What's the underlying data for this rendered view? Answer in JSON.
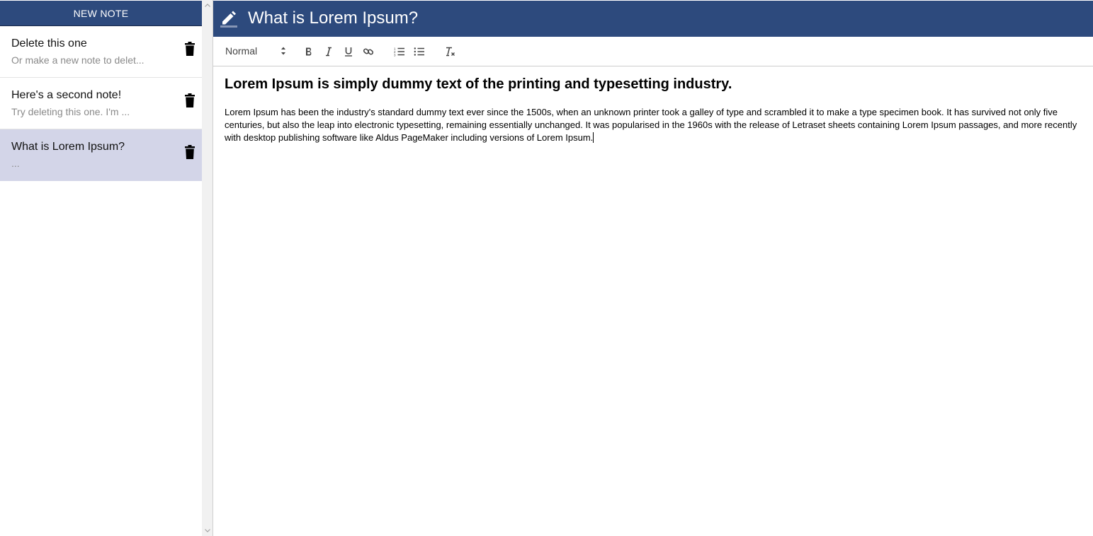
{
  "sidebar": {
    "new_note_label": "NEW NOTE",
    "notes": [
      {
        "title": "Delete this one",
        "preview": "Or make a new note to delet..."
      },
      {
        "title": "Here's a second note!",
        "preview": "Try deleting this one. I'm ..."
      },
      {
        "title": "What is Lorem Ipsum?",
        "preview": "..."
      }
    ],
    "selected_index": 2
  },
  "editor": {
    "title": "What is Lorem Ipsum?",
    "toolbar": {
      "format_value": "Normal",
      "buttons": [
        "bold-icon",
        "italic-icon",
        "underline-icon",
        "link-icon",
        "ordered-list-icon",
        "bullet-list-icon",
        "clear-format-icon"
      ]
    },
    "heading": "Lorem Ipsum is simply dummy text of the printing and typesetting industry.",
    "body": "Lorem Ipsum has been the industry's standard dummy text ever since the 1500s, when an unknown printer took a galley of type and scrambled it to make a type specimen book. It has survived not only five centuries, but also the leap into electronic typesetting, remaining essentially unchanged. It was popularised in the 1960s with the release of Letraset sheets containing Lorem Ipsum passages, and more recently with desktop publishing software like Aldus PageMaker including versions of Lorem Ipsum."
  },
  "colors": {
    "accent": "#2d4a7d",
    "selected_note_bg": "#d3d5e8"
  }
}
